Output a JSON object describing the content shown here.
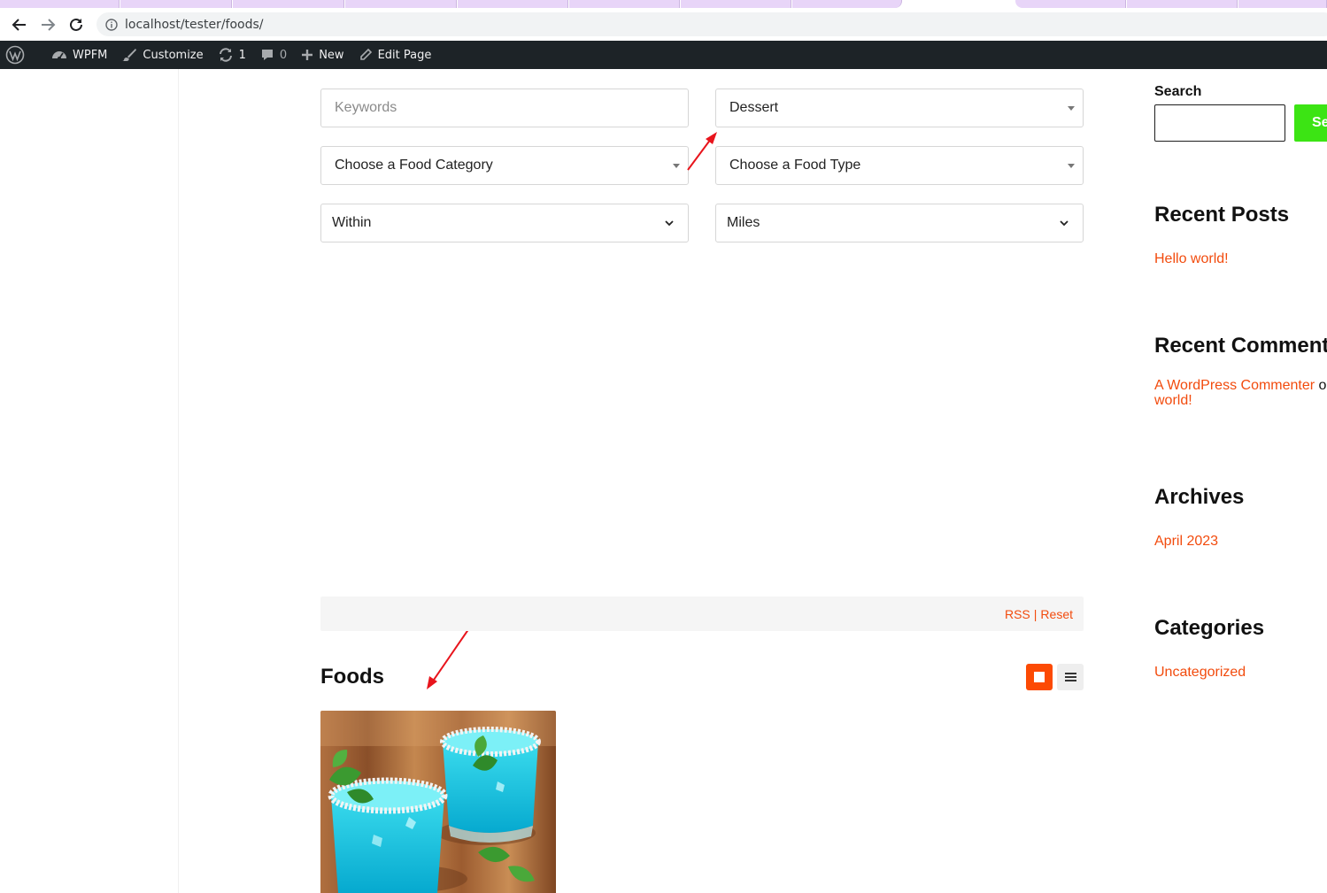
{
  "browser": {
    "url": "localhost/tester/foods/"
  },
  "admin_bar": {
    "site": "WPFM",
    "customize": "Customize",
    "updates_count": "1",
    "comments_count": "0",
    "new": "New",
    "edit_page": "Edit Page"
  },
  "filters": {
    "keywords_placeholder": "Keywords",
    "dessert_value": "Dessert",
    "food_category": "Choose a Food Category",
    "food_type": "Choose a Food Type",
    "within": "Within",
    "miles": "Miles"
  },
  "results_bar": {
    "rss": "RSS",
    "separator": "|",
    "reset": "Reset"
  },
  "listing": {
    "title": "Foods"
  },
  "sidebar": {
    "search_label": "Search",
    "search_button": "Se",
    "recent_posts_title": "Recent Posts",
    "recent_post_1": "Hello world!",
    "recent_comments_title": "Recent Comments",
    "comment_author": "A WordPress Commenter",
    "comment_on": "on",
    "comment_post": "world!",
    "archives_title": "Archives",
    "archive_1": "April 2023",
    "categories_title": "Categories",
    "category_1": "Uncategorized"
  },
  "colors": {
    "accent": "#f24b0d",
    "grid_button": "#fc4a04",
    "search_button": "#3ce414",
    "admin_bar": "#1d2327"
  },
  "icons": {
    "back": "arrow-left-icon",
    "forward": "arrow-right-icon",
    "reload": "reload-icon",
    "info": "info-icon",
    "wordpress": "wordpress-logo-icon",
    "dashboard": "dashboard-icon",
    "customize": "brush-icon",
    "updates": "updates-icon",
    "comments": "comment-icon",
    "new": "plus-icon",
    "edit": "pencil-icon",
    "grid": "grid-view-icon",
    "list": "list-view-icon"
  }
}
